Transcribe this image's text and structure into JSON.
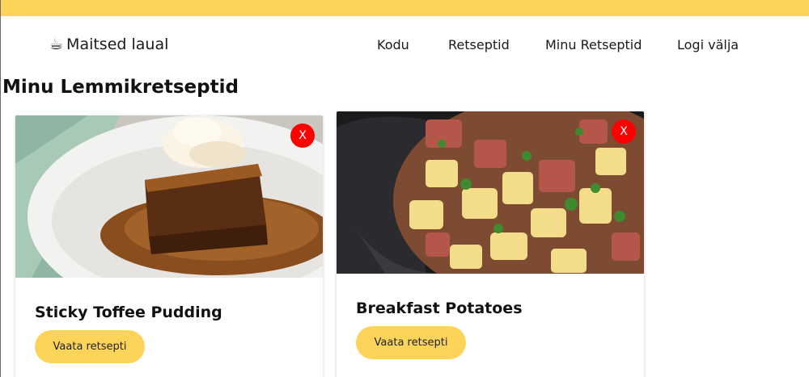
{
  "header": {
    "brand_icon": "coffee-cup-icon",
    "brand_glyph": "☕",
    "brand_name": "Maitsed laual",
    "accent_color": "#fdd45a"
  },
  "nav": {
    "items": [
      {
        "label": "Kodu"
      },
      {
        "label": "Retseptid"
      },
      {
        "label": "Minu Retseptid"
      },
      {
        "label": "Logi välja"
      }
    ]
  },
  "main": {
    "title": "Minu Lemmikretseptid",
    "recipes": [
      {
        "title": "Sticky Toffee Pudding",
        "remove_label": "X",
        "view_label": "Vaata retsepti",
        "image": "sticky-toffee-pudding-photo"
      },
      {
        "title": "Breakfast Potatoes",
        "remove_label": "X",
        "view_label": "Vaata retsepti",
        "image": "breakfast-potatoes-photo"
      }
    ],
    "remove_color": "#ff0000"
  }
}
